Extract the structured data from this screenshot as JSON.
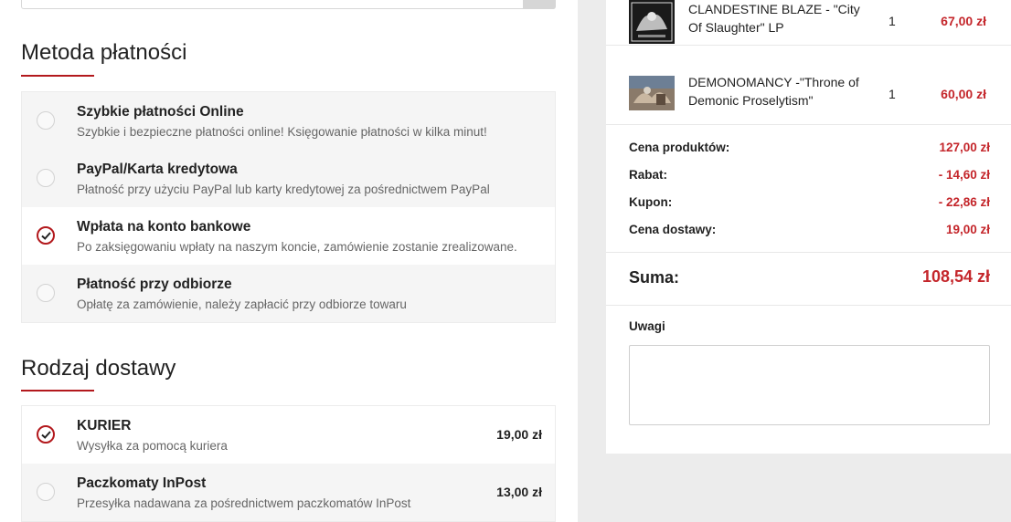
{
  "payment": {
    "title": "Metoda płatności",
    "options": [
      {
        "title": "Szybkie płatności Online",
        "desc": "Szybkie i bezpieczne płatności online! Księgowanie płatności w kilka minut!",
        "selected": false
      },
      {
        "title": "PayPal/Karta kredytowa",
        "desc": "Płatność przy użyciu PayPal lub karty kredytowej za pośrednictwem PayPal",
        "selected": false
      },
      {
        "title": "Wpłata na konto bankowe",
        "desc": "Po zaksięgowaniu wpłaty na naszym koncie, zamówienie zostanie zrealizowane.",
        "selected": true
      },
      {
        "title": "Płatność przy odbiorze",
        "desc": "Opłatę za zamówienie, należy zapłacić przy odbiorze towaru",
        "selected": false
      }
    ]
  },
  "delivery": {
    "title": "Rodzaj dostawy",
    "options": [
      {
        "title": "KURIER",
        "desc": "Wysyłka za pomocą kuriera",
        "price": "19,00 zł",
        "selected": true
      },
      {
        "title": "Paczkomaty InPost",
        "desc": "Przesyłka nadawana za pośrednictwem paczkomatów InPost",
        "price": "13,00 zł",
        "selected": false
      }
    ]
  },
  "cart": {
    "products": [
      {
        "name": "CLANDESTINE BLAZE - \"City Of Slaughter\" LP",
        "qty": "1",
        "price": "67,00 zł"
      },
      {
        "name": "DEMONOMANCY -\"Throne of Demonic Proselytism\"",
        "qty": "1",
        "price": "60,00 zł"
      }
    ],
    "summary": [
      {
        "label": "Cena produktów:",
        "value": "127,00 zł"
      },
      {
        "label": "Rabat:",
        "value": "- 14,60 zł"
      },
      {
        "label": "Kupon:",
        "value": "- 22,86 zł"
      },
      {
        "label": "Cena dostawy:",
        "value": "19,00 zł"
      }
    ],
    "total_label": "Suma:",
    "total_value": "108,54 zł",
    "notes_label": "Uwagi",
    "notes_value": ""
  },
  "colors": {
    "accent": "#b3191d",
    "price": "#c4262b",
    "option_bg": "#f5f5f5",
    "side_bg": "#ececec"
  }
}
